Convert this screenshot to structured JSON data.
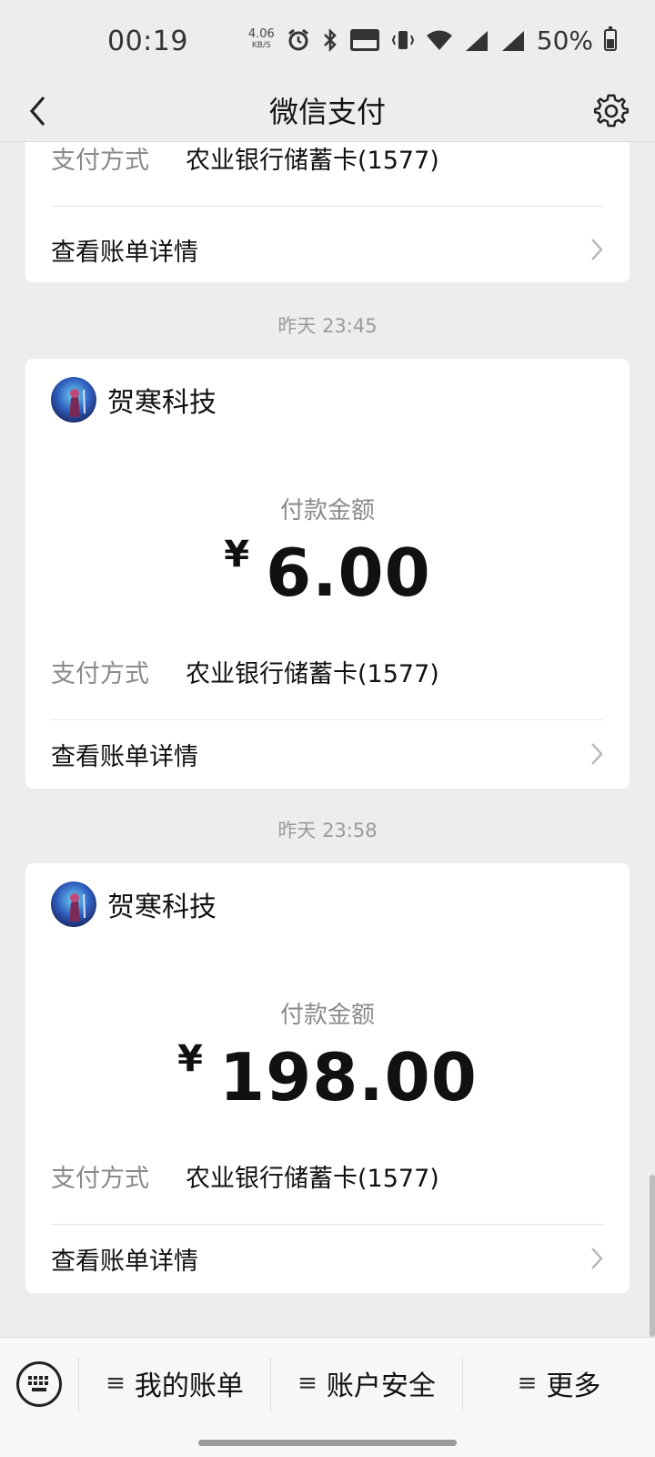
{
  "status_bar": {
    "time": "00:19",
    "net_speed": "4.06",
    "net_speed_unit": "KB/S",
    "icons": [
      "alarm-icon",
      "bluetooth-icon",
      "volte-icon",
      "vibrate-icon",
      "wifi-icon",
      "signal-5g-icon",
      "signal-4g-icon"
    ],
    "battery_percent": "50%"
  },
  "nav": {
    "title": "微信支付",
    "back_icon": "chevron-left-icon",
    "settings_icon": "gear-icon"
  },
  "feed": {
    "partial_card": {
      "method_label": "支付方式",
      "method_value": "农业银行储蓄卡(1577)",
      "detail_label": "查看账单详情"
    },
    "cards": [
      {
        "timestamp": "昨天 23:45",
        "merchant": "贺寒科技",
        "amount_label": "付款金额",
        "currency": "¥",
        "amount": "6.00",
        "method_label": "支付方式",
        "method_value": "农业银行储蓄卡(1577)",
        "detail_label": "查看账单详情"
      },
      {
        "timestamp": "昨天 23:58",
        "merchant": "贺寒科技",
        "amount_label": "付款金额",
        "currency": "¥",
        "amount": "198.00",
        "method_label": "支付方式",
        "method_value": "农业银行储蓄卡(1577)",
        "detail_label": "查看账单详情"
      }
    ]
  },
  "bottom_menu": {
    "keyboard_icon": "keyboard-icon",
    "items": [
      {
        "label": "我的账单"
      },
      {
        "label": "账户安全"
      },
      {
        "label": "更多"
      }
    ]
  },
  "colors": {
    "background": "#ededed",
    "card": "#ffffff",
    "secondary_text": "#8a8a8a"
  }
}
